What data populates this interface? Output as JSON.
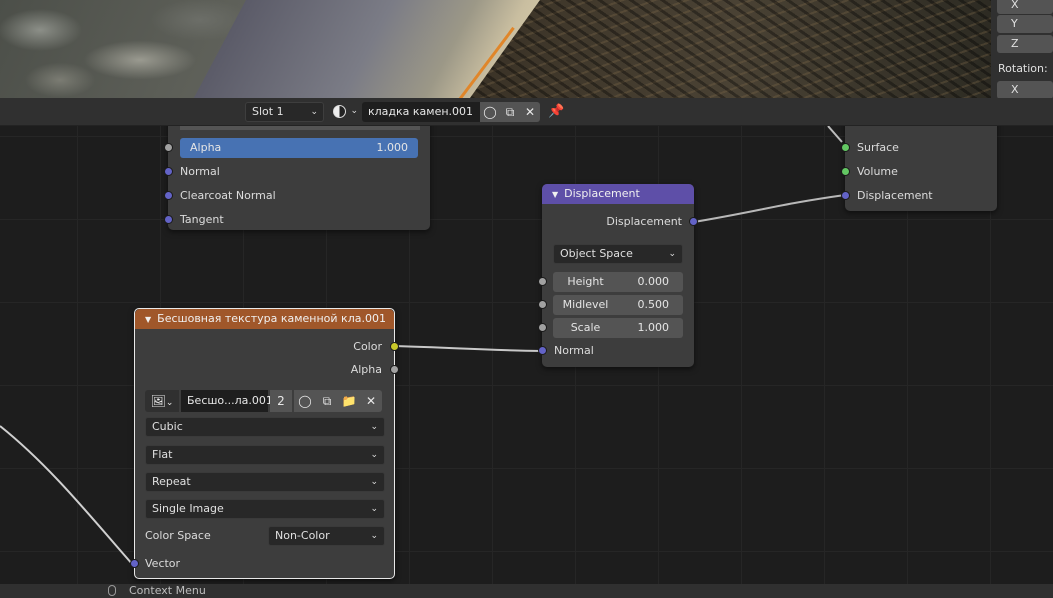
{
  "viewport": {
    "n_panel": {
      "axis_labels": [
        "X",
        "Y",
        "Z"
      ],
      "rotation_label": "Rotation:",
      "rotation_axis": "X"
    }
  },
  "header": {
    "slot": "Slot 1",
    "material_name": "кладка камен.001"
  },
  "nodes": {
    "principled": {
      "alpha_label": "Alpha",
      "alpha_value": "1.000",
      "inputs": [
        "Normal",
        "Clearcoat Normal",
        "Tangent"
      ]
    },
    "output": {
      "inputs": [
        "Surface",
        "Volume",
        "Displacement"
      ]
    },
    "displacement": {
      "title": "Displacement",
      "output": "Displacement",
      "space": "Object Space",
      "height_label": "Height",
      "height_value": "0.000",
      "midlevel_label": "Midlevel",
      "midlevel_value": "0.500",
      "scale_label": "Scale",
      "scale_value": "1.000",
      "normal_label": "Normal"
    },
    "image_texture": {
      "title": "Бесшовная текстура каменной кла.001",
      "output_color": "Color",
      "output_alpha": "Alpha",
      "image_name": "Бесшо...ла.001",
      "users": "2",
      "interpolation": "Cubic",
      "projection": "Flat",
      "extension": "Repeat",
      "source": "Single Image",
      "color_space_label": "Color Space",
      "color_space": "Non-Color",
      "vector_label": "Vector"
    }
  },
  "statusbar": {
    "hint": "Context Menu"
  },
  "colors": {
    "vector_socket": "#6363c7",
    "float_socket": "#a1a1a1",
    "color_socket": "#c7c729",
    "shader_socket": "#63c763",
    "texture_header": "#a0572a",
    "vector_header": "#5e4fa8",
    "alpha_slider": "#4772b3",
    "link": "#b8b8b8"
  }
}
